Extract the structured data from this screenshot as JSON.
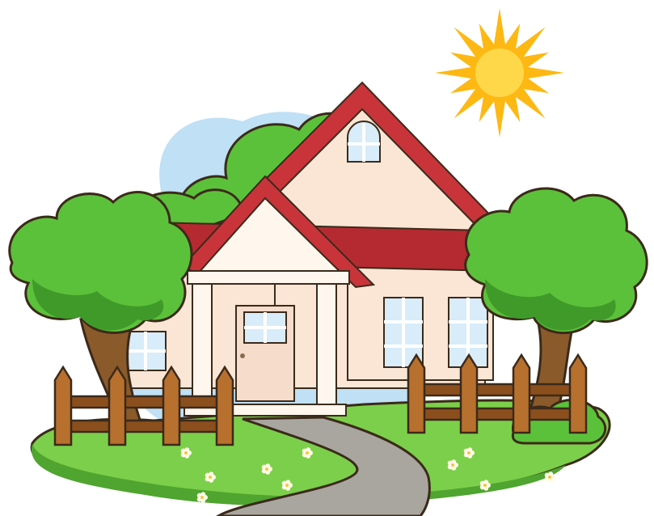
{
  "scene": {
    "subject": "house-clipart",
    "colors": {
      "sky": "#bfe0f5",
      "sun": "#fdb813",
      "sun_core": "#ffd84a",
      "wall": "#fbe6d6",
      "wall_shade": "#f2d4c0",
      "roof": "#c8343a",
      "roof_tiles": "#b52a30",
      "trim": "#fff6ee",
      "window_glass": "#d8ecfa",
      "window_frame": "#ffffff",
      "door": "#f6dccb",
      "tree_leaf": "#5cc13a",
      "tree_leaf_dark": "#3f9a2a",
      "trunk": "#8a5a2b",
      "fence": "#b8702e",
      "fence_dark": "#8b4f1d",
      "grass": "#7ccf4a",
      "grass_dark": "#4fa52f",
      "path": "#a9a6a0",
      "outline": "#3b2a1a"
    },
    "icons": [
      "sun-icon",
      "tree-icon",
      "fence-icon",
      "window-icon",
      "door-icon",
      "flower-icon"
    ]
  }
}
